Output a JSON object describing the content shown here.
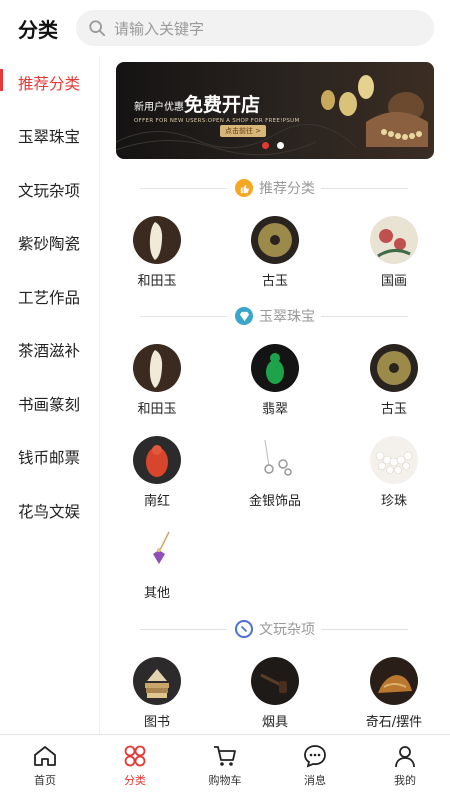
{
  "header": {
    "title": "分类",
    "search_placeholder": "请输入关键字"
  },
  "sidebar": {
    "items": [
      {
        "label": "推荐分类"
      },
      {
        "label": "玉翠珠宝"
      },
      {
        "label": "文玩杂项"
      },
      {
        "label": "紫砂陶瓷"
      },
      {
        "label": "工艺作品"
      },
      {
        "label": "茶酒滋补"
      },
      {
        "label": "书画篆刻"
      },
      {
        "label": "钱币邮票"
      },
      {
        "label": "花鸟文娱"
      }
    ]
  },
  "banner": {
    "small_text": "新用户优惠",
    "big_text": "免费开店",
    "english_text": "OFFER FOR NEW USERS:OPEN A SHOP FOR FREE!PSUM",
    "button": "点击前往 >"
  },
  "sections": [
    {
      "title": "推荐分类",
      "icon": "thumb-icon",
      "color": "#f5a623",
      "items": [
        {
          "label": "和田玉"
        },
        {
          "label": "古玉"
        },
        {
          "label": "国画"
        }
      ]
    },
    {
      "title": "玉翠珠宝",
      "icon": "gem-icon",
      "color": "#3aa6c9",
      "items": [
        {
          "label": "和田玉"
        },
        {
          "label": "翡翠"
        },
        {
          "label": "古玉"
        },
        {
          "label": "南红"
        },
        {
          "label": "金银饰品"
        },
        {
          "label": "珍珠"
        },
        {
          "label": "其他"
        }
      ]
    },
    {
      "title": "文玩杂项",
      "icon": "ring-icon",
      "color": "#4d6fd1",
      "items": [
        {
          "label": "图书"
        },
        {
          "label": "烟具"
        },
        {
          "label": "奇石/摆件"
        }
      ]
    }
  ],
  "tabbar": {
    "items": [
      {
        "label": "首页",
        "icon": "home-icon"
      },
      {
        "label": "分类",
        "icon": "category-icon"
      },
      {
        "label": "购物车",
        "icon": "cart-icon"
      },
      {
        "label": "消息",
        "icon": "message-icon"
      },
      {
        "label": "我的",
        "icon": "profile-icon"
      }
    ],
    "active": "分类"
  },
  "colors": {
    "accent": "#e53935"
  }
}
